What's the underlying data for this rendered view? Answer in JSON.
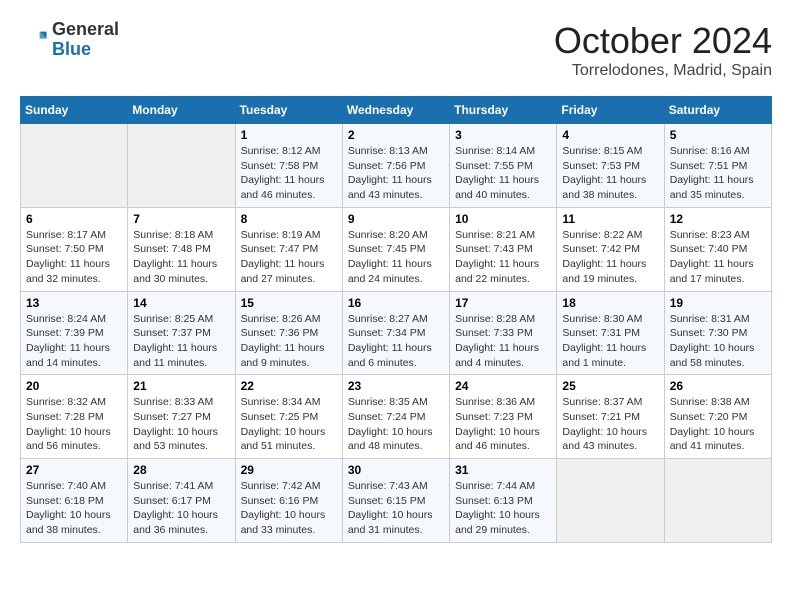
{
  "header": {
    "logo_general": "General",
    "logo_blue": "Blue",
    "month": "October 2024",
    "location": "Torrelodones, Madrid, Spain"
  },
  "days_of_week": [
    "Sunday",
    "Monday",
    "Tuesday",
    "Wednesday",
    "Thursday",
    "Friday",
    "Saturday"
  ],
  "weeks": [
    [
      {
        "day": "",
        "info": ""
      },
      {
        "day": "",
        "info": ""
      },
      {
        "day": "1",
        "info": "Sunrise: 8:12 AM\nSunset: 7:58 PM\nDaylight: 11 hours and 46 minutes."
      },
      {
        "day": "2",
        "info": "Sunrise: 8:13 AM\nSunset: 7:56 PM\nDaylight: 11 hours and 43 minutes."
      },
      {
        "day": "3",
        "info": "Sunrise: 8:14 AM\nSunset: 7:55 PM\nDaylight: 11 hours and 40 minutes."
      },
      {
        "day": "4",
        "info": "Sunrise: 8:15 AM\nSunset: 7:53 PM\nDaylight: 11 hours and 38 minutes."
      },
      {
        "day": "5",
        "info": "Sunrise: 8:16 AM\nSunset: 7:51 PM\nDaylight: 11 hours and 35 minutes."
      }
    ],
    [
      {
        "day": "6",
        "info": "Sunrise: 8:17 AM\nSunset: 7:50 PM\nDaylight: 11 hours and 32 minutes."
      },
      {
        "day": "7",
        "info": "Sunrise: 8:18 AM\nSunset: 7:48 PM\nDaylight: 11 hours and 30 minutes."
      },
      {
        "day": "8",
        "info": "Sunrise: 8:19 AM\nSunset: 7:47 PM\nDaylight: 11 hours and 27 minutes."
      },
      {
        "day": "9",
        "info": "Sunrise: 8:20 AM\nSunset: 7:45 PM\nDaylight: 11 hours and 24 minutes."
      },
      {
        "day": "10",
        "info": "Sunrise: 8:21 AM\nSunset: 7:43 PM\nDaylight: 11 hours and 22 minutes."
      },
      {
        "day": "11",
        "info": "Sunrise: 8:22 AM\nSunset: 7:42 PM\nDaylight: 11 hours and 19 minutes."
      },
      {
        "day": "12",
        "info": "Sunrise: 8:23 AM\nSunset: 7:40 PM\nDaylight: 11 hours and 17 minutes."
      }
    ],
    [
      {
        "day": "13",
        "info": "Sunrise: 8:24 AM\nSunset: 7:39 PM\nDaylight: 11 hours and 14 minutes."
      },
      {
        "day": "14",
        "info": "Sunrise: 8:25 AM\nSunset: 7:37 PM\nDaylight: 11 hours and 11 minutes."
      },
      {
        "day": "15",
        "info": "Sunrise: 8:26 AM\nSunset: 7:36 PM\nDaylight: 11 hours and 9 minutes."
      },
      {
        "day": "16",
        "info": "Sunrise: 8:27 AM\nSunset: 7:34 PM\nDaylight: 11 hours and 6 minutes."
      },
      {
        "day": "17",
        "info": "Sunrise: 8:28 AM\nSunset: 7:33 PM\nDaylight: 11 hours and 4 minutes."
      },
      {
        "day": "18",
        "info": "Sunrise: 8:30 AM\nSunset: 7:31 PM\nDaylight: 11 hours and 1 minute."
      },
      {
        "day": "19",
        "info": "Sunrise: 8:31 AM\nSunset: 7:30 PM\nDaylight: 10 hours and 58 minutes."
      }
    ],
    [
      {
        "day": "20",
        "info": "Sunrise: 8:32 AM\nSunset: 7:28 PM\nDaylight: 10 hours and 56 minutes."
      },
      {
        "day": "21",
        "info": "Sunrise: 8:33 AM\nSunset: 7:27 PM\nDaylight: 10 hours and 53 minutes."
      },
      {
        "day": "22",
        "info": "Sunrise: 8:34 AM\nSunset: 7:25 PM\nDaylight: 10 hours and 51 minutes."
      },
      {
        "day": "23",
        "info": "Sunrise: 8:35 AM\nSunset: 7:24 PM\nDaylight: 10 hours and 48 minutes."
      },
      {
        "day": "24",
        "info": "Sunrise: 8:36 AM\nSunset: 7:23 PM\nDaylight: 10 hours and 46 minutes."
      },
      {
        "day": "25",
        "info": "Sunrise: 8:37 AM\nSunset: 7:21 PM\nDaylight: 10 hours and 43 minutes."
      },
      {
        "day": "26",
        "info": "Sunrise: 8:38 AM\nSunset: 7:20 PM\nDaylight: 10 hours and 41 minutes."
      }
    ],
    [
      {
        "day": "27",
        "info": "Sunrise: 7:40 AM\nSunset: 6:18 PM\nDaylight: 10 hours and 38 minutes."
      },
      {
        "day": "28",
        "info": "Sunrise: 7:41 AM\nSunset: 6:17 PM\nDaylight: 10 hours and 36 minutes."
      },
      {
        "day": "29",
        "info": "Sunrise: 7:42 AM\nSunset: 6:16 PM\nDaylight: 10 hours and 33 minutes."
      },
      {
        "day": "30",
        "info": "Sunrise: 7:43 AM\nSunset: 6:15 PM\nDaylight: 10 hours and 31 minutes."
      },
      {
        "day": "31",
        "info": "Sunrise: 7:44 AM\nSunset: 6:13 PM\nDaylight: 10 hours and 29 minutes."
      },
      {
        "day": "",
        "info": ""
      },
      {
        "day": "",
        "info": ""
      }
    ]
  ]
}
